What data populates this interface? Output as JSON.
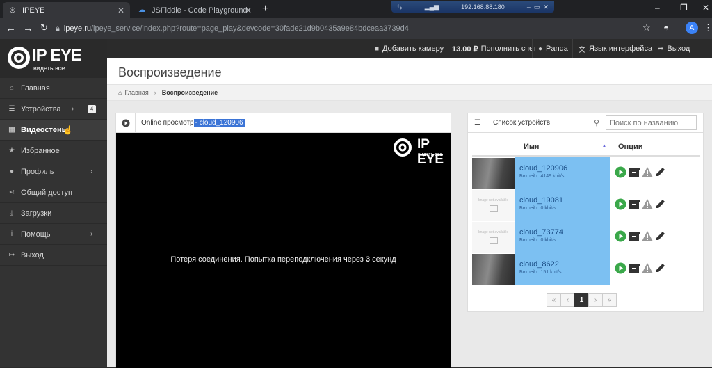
{
  "browser": {
    "tabs": [
      {
        "title": "IPEYE",
        "active": true
      },
      {
        "title": "JSFiddle - Code Playground",
        "active": false
      }
    ],
    "remote_ip": "192.168.88.180",
    "url_host": "ipeye.ru",
    "url_path": "/ipeye_service/index.php?route=page_play&devcode=30fade21d9b0435a9e84bdceaa3739d4",
    "profile_initial": "A"
  },
  "logo": {
    "text": "IP EYE",
    "tagline": "видеть все"
  },
  "topbar": {
    "add_camera": "Добавить камеру",
    "balance": "13.00 ₽",
    "topup": "Пополнить счет",
    "user": "Panda",
    "language": "Язык интерфейса",
    "logout": "Выход"
  },
  "sidebar": {
    "items": [
      {
        "label": "Главная",
        "icon": "home-icon"
      },
      {
        "label": "Устройства",
        "icon": "list-icon",
        "badge": "4"
      },
      {
        "label": "Видеостены",
        "icon": "grid-icon"
      },
      {
        "label": "Избранное",
        "icon": "star-icon"
      },
      {
        "label": "Профиль",
        "icon": "user-icon"
      },
      {
        "label": "Общий доступ",
        "icon": "share-icon"
      },
      {
        "label": "Загрузки",
        "icon": "download-icon"
      },
      {
        "label": "Помощь",
        "icon": "info-icon"
      },
      {
        "label": "Выход",
        "icon": "logout-icon"
      }
    ]
  },
  "page": {
    "title": "Воспроизведение",
    "breadcrumb_home": "Главная",
    "breadcrumb_current": "Воспроизведение"
  },
  "player": {
    "title_prefix": "Online просмотр",
    "title_selected": " - cloud_120906",
    "message_a": "Потеря соединения. Попытка переподключения через ",
    "message_count": "3",
    "message_b": " секунд"
  },
  "devices": {
    "title": "Список устройств",
    "search_placeholder": "Поиск по названию",
    "col_name": "Имя",
    "col_options": "Опции",
    "no_image_text": "Image not available",
    "rows": [
      {
        "name": "cloud_120906",
        "bitrate": "Битрейт: 4149 kbit/s",
        "thumb": "dark"
      },
      {
        "name": "cloud_19081",
        "bitrate": "Битрейт: 0 kbit/s",
        "thumb": "empty"
      },
      {
        "name": "cloud_73774",
        "bitrate": "Битрейт: 0 kbit/s",
        "thumb": "empty"
      },
      {
        "name": "cloud_8622",
        "bitrate": "Битрейт: 151 kbit/s",
        "thumb": "dark"
      }
    ]
  },
  "pager": {
    "first": "«",
    "prev": "‹",
    "current": "1",
    "next": "›",
    "last": "»"
  },
  "colors": {
    "accent": "#7cc0f2",
    "play_green": "#3aa84a"
  }
}
